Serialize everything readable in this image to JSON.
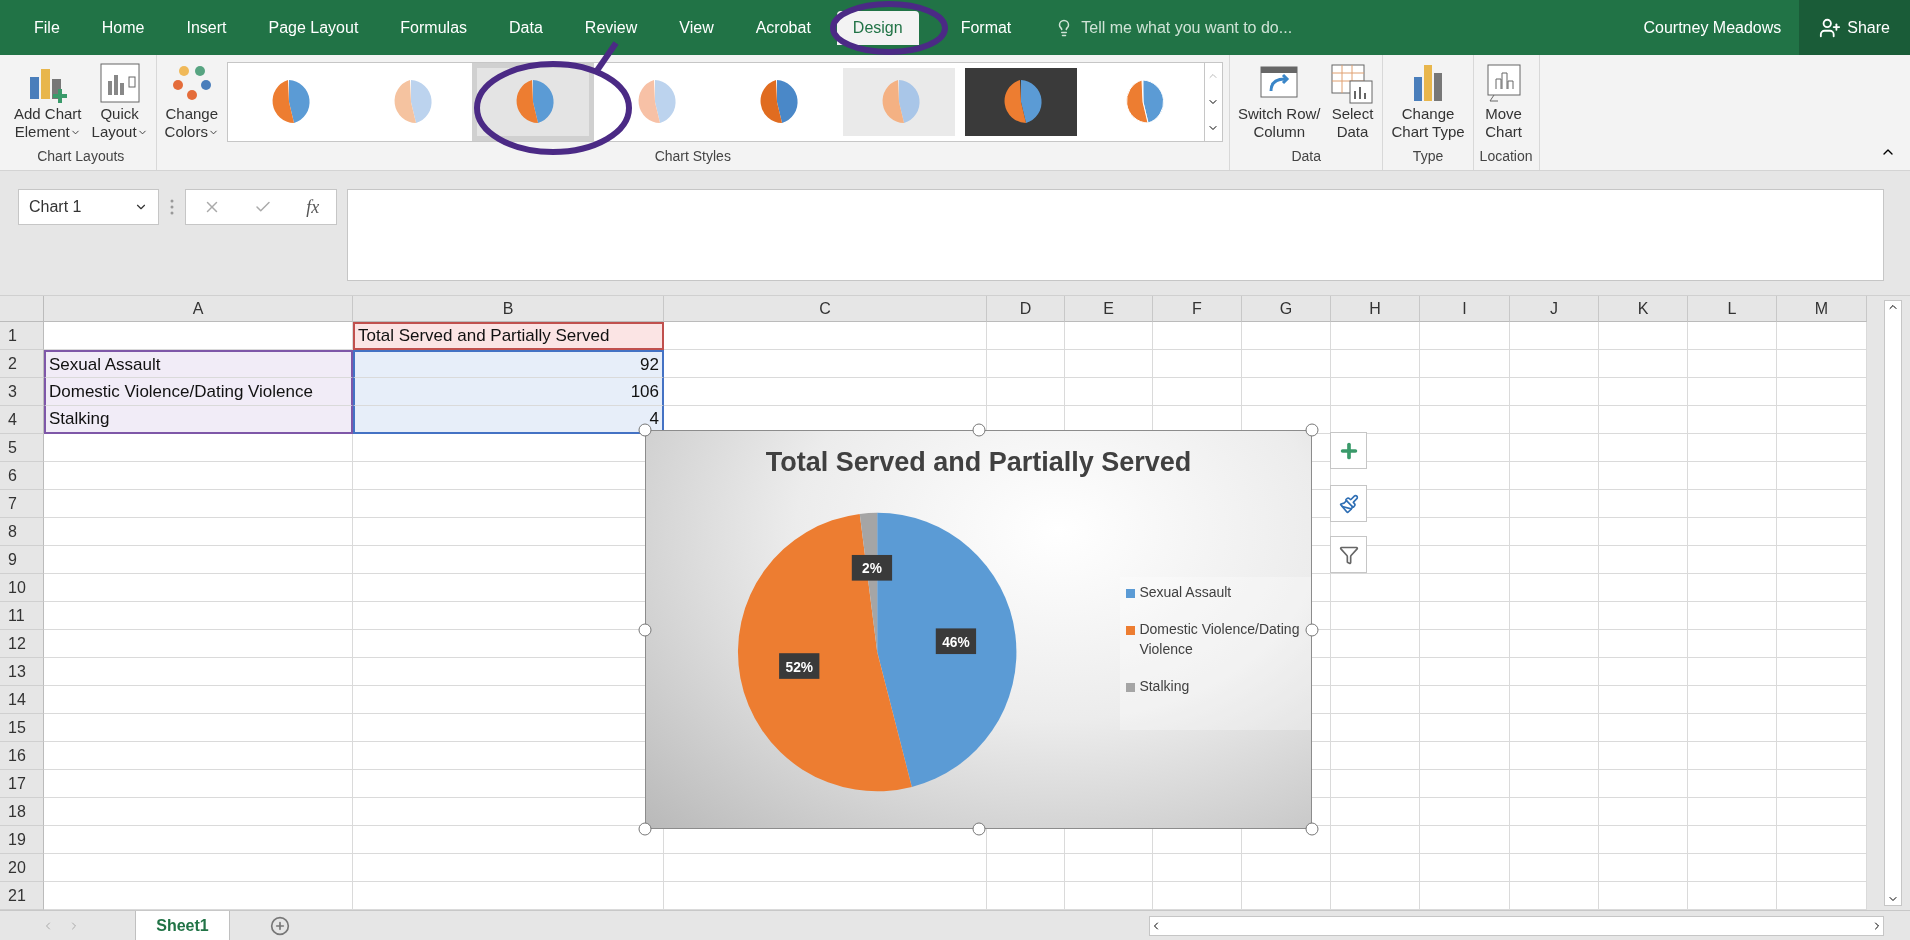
{
  "menu_tabs": [
    {
      "label": "File",
      "selected": false
    },
    {
      "label": "Home",
      "selected": false
    },
    {
      "label": "Insert",
      "selected": false
    },
    {
      "label": "Page Layout",
      "selected": false
    },
    {
      "label": "Formulas",
      "selected": false
    },
    {
      "label": "Data",
      "selected": false
    },
    {
      "label": "Review",
      "selected": false
    },
    {
      "label": "View",
      "selected": false
    },
    {
      "label": "Acrobat",
      "selected": false
    },
    {
      "label": "Design",
      "selected": true
    },
    {
      "label": "Format",
      "selected": false
    }
  ],
  "tell_me": {
    "placeholder": "Tell me what you want to do..."
  },
  "user": "Courtney Meadows",
  "share_button": "Share",
  "ribbon": {
    "groups": [
      {
        "label": "Chart Layouts",
        "buttons": [
          {
            "kind": "add-element",
            "lines": [
              "Add Chart",
              "Element"
            ],
            "dropdown": true
          },
          {
            "kind": "quick-layout",
            "lines": [
              "Quick",
              "Layout"
            ],
            "dropdown": true
          }
        ]
      },
      {
        "label": "Chart Styles",
        "buttons": [
          {
            "kind": "colors",
            "lines": [
              "Change",
              "Colors"
            ],
            "dropdown": true
          }
        ],
        "gallery": [
          {
            "kind": "plain",
            "selected": false
          },
          {
            "kind": "hatched",
            "selected": false
          },
          {
            "kind": "shaded",
            "selected": true
          },
          {
            "kind": "pastel",
            "selected": false
          },
          {
            "kind": "bold",
            "selected": false
          },
          {
            "kind": "striped",
            "selected": false
          },
          {
            "kind": "dark",
            "selected": false
          },
          {
            "kind": "labels",
            "selected": false
          }
        ]
      },
      {
        "label": "Data",
        "buttons": [
          {
            "kind": "switch",
            "lines": [
              "Switch Row/",
              "Column"
            ],
            "dropdown": false
          },
          {
            "kind": "select-data",
            "lines": [
              "Select",
              "Data"
            ],
            "dropdown": false
          }
        ]
      },
      {
        "label": "Type",
        "buttons": [
          {
            "kind": "chart-type",
            "lines": [
              "Change",
              "Chart Type"
            ],
            "dropdown": false
          }
        ]
      },
      {
        "label": "Location",
        "buttons": [
          {
            "kind": "move",
            "lines": [
              "Move",
              "Chart"
            ],
            "dropdown": false
          }
        ]
      }
    ]
  },
  "formula_bar": {
    "name_box": "Chart 1",
    "function_button": "fx"
  },
  "sheet": {
    "columns": [
      "A",
      "B",
      "C",
      "D",
      "E",
      "F",
      "G",
      "H",
      "I",
      "J",
      "K",
      "L",
      "M"
    ],
    "rows": [
      {
        "number": "1",
        "series_name": "Total Served and Partially Served"
      },
      {
        "number": "2",
        "category": "Sexual Assault",
        "value": "92"
      },
      {
        "number": "3",
        "category": "Domestic Violence/Dating Violence",
        "value": "106"
      },
      {
        "number": "4",
        "category": "Stalking",
        "value": "4"
      },
      {
        "number": "5"
      },
      {
        "number": "6"
      },
      {
        "number": "7"
      },
      {
        "number": "8"
      },
      {
        "number": "9"
      },
      {
        "number": "10"
      },
      {
        "number": "11"
      },
      {
        "number": "12"
      },
      {
        "number": "13"
      },
      {
        "number": "14"
      },
      {
        "number": "15"
      },
      {
        "number": "16"
      },
      {
        "number": "17"
      },
      {
        "number": "18"
      },
      {
        "number": "19"
      },
      {
        "number": "20"
      },
      {
        "number": "21"
      }
    ]
  },
  "chart": {
    "chart_data": {
      "type": "pie",
      "title": "Total Served and Partially Served",
      "categories": [
        "Sexual Assault",
        "Domestic Violence/Dating Violence",
        "Stalking"
      ],
      "values": [
        46,
        52,
        2
      ],
      "colors": [
        "#5b9bd5",
        "#ed7d31",
        "#a5a5a5"
      ],
      "value_labels": [
        "46%",
        "52%",
        "2%"
      ]
    }
  },
  "sheet_tabs": [
    {
      "label": "Sheet1",
      "selected": true
    }
  ]
}
